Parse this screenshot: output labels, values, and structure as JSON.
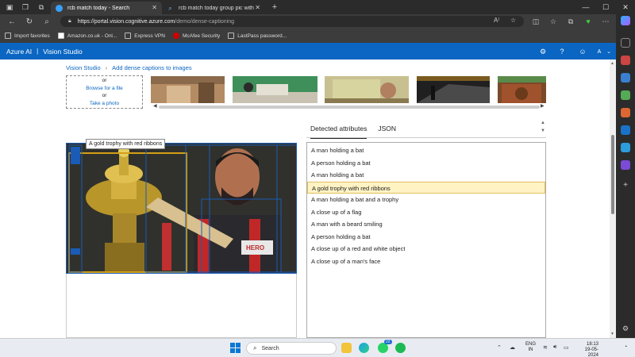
{
  "browser": {
    "tabs": [
      {
        "title": "rcb match today - Search",
        "active": true,
        "favicon": "search-icon"
      },
      {
        "title": "rcb match today group pic with",
        "active": false,
        "favicon": "search-icon"
      }
    ],
    "new_tab_label": "+",
    "url_host": "https://portal.vision.cognitive.azure.com",
    "url_path": "/demo/dense-captioning",
    "favorites": [
      {
        "label": "Import favorites",
        "icon": "import-icon"
      },
      {
        "label": "Amazon.co.uk - Onl...",
        "icon": "amazon-icon"
      },
      {
        "label": "Express VPN",
        "icon": "page-icon"
      },
      {
        "label": "McAfee Security",
        "icon": "mcafee-icon"
      },
      {
        "label": "LastPass password...",
        "icon": "page-icon"
      }
    ]
  },
  "app": {
    "brand": "Azure AI",
    "separator": "|",
    "product": "Vision Studio",
    "user_initial": "A"
  },
  "breadcrumb": {
    "root": "Vision Studio",
    "current": "Add dense captions to images"
  },
  "upload": {
    "or1": "or",
    "browse": "Browse for a file",
    "or2": "or",
    "photo": "Take a photo"
  },
  "image": {
    "tooltip": "A gold trophy with red ribbons",
    "jersey_text": "HERO"
  },
  "attributes": {
    "tab_detected": "Detected attributes",
    "tab_json": "JSON",
    "items": [
      "A man holding a bat",
      "A person holding a bat",
      "A man holding a bat",
      "A gold trophy with red ribbons",
      "A man holding a bat and a trophy",
      "A close up of a flag",
      "A man with a beard smiling",
      "A person holding a bat",
      "A close up of a red and white object",
      "A close up of a man's face"
    ],
    "selected_index": 3
  },
  "taskbar": {
    "search_placeholder": "Search",
    "whatsapp_badge": "22",
    "lang_top": "ENG",
    "lang_bottom": "IN",
    "time": "18:13",
    "date": "19-05-2024"
  },
  "colors": {
    "azure_blue": "#0a66c2",
    "selection_bg": "#fff3c4",
    "box_gold": "#d4a017",
    "box_blue": "#1a5bb5"
  }
}
